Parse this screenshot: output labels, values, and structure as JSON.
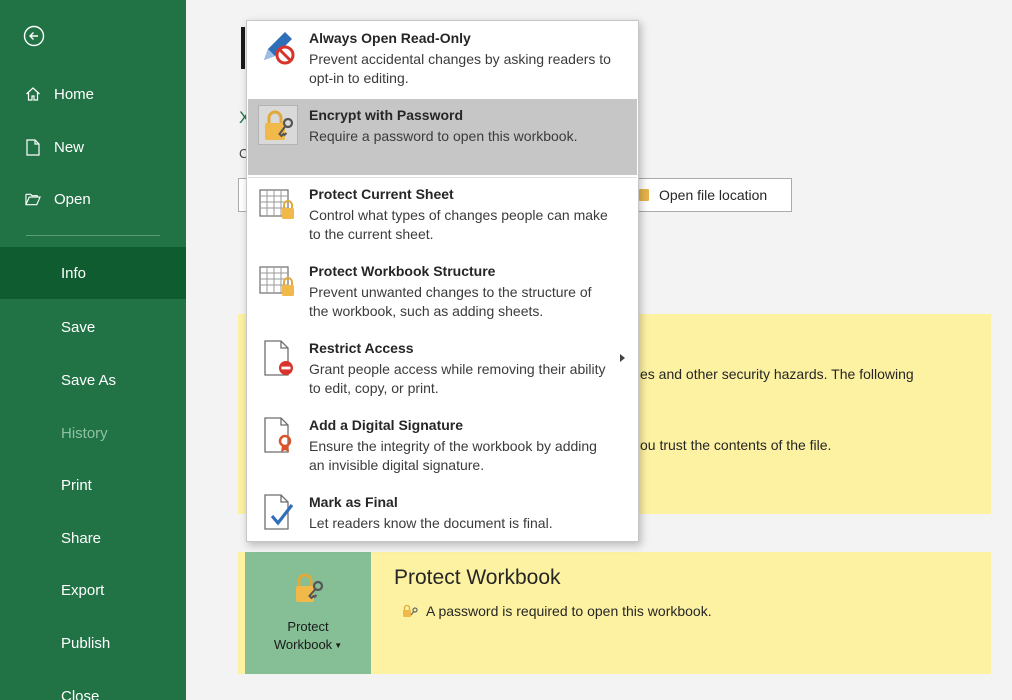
{
  "sidebar": {
    "back_icon": "back-arrow-circle-icon",
    "items": [
      {
        "label": "Home",
        "icon": "home-icon"
      },
      {
        "label": "New",
        "icon": "new-document-icon"
      },
      {
        "label": "Open",
        "icon": "open-folder-icon"
      },
      {
        "label": "Info"
      },
      {
        "label": "Save"
      },
      {
        "label": "Save As"
      },
      {
        "label": "History"
      },
      {
        "label": "Print"
      },
      {
        "label": "Share"
      },
      {
        "label": "Export"
      },
      {
        "label": "Publish"
      },
      {
        "label": "Close"
      }
    ],
    "active": "Info",
    "disabled": "History",
    "colors": {
      "background": "#217346",
      "active": "#0e5c2f"
    }
  },
  "info": {
    "workbook_icon_letter": "X",
    "path_letter": "C",
    "open_file_location": "Open file location",
    "security_warning_line1": "es and other security hazards. The following",
    "security_warning_line2": "ou trust the contents of the file.",
    "protect_workbook": {
      "button_label_line1": "Protect",
      "button_label_line2": "Workbook",
      "title": "Protect Workbook",
      "description": "A password is required to open this workbook."
    }
  },
  "protect_menu": {
    "items": [
      {
        "title": "Always Open Read-Only",
        "description": "Prevent accidental changes by asking readers to opt-in to editing.",
        "icon": "pencil-prohibited-icon"
      },
      {
        "title": "Encrypt with Password",
        "description": "Require a password to open this workbook.",
        "icon": "lock-key-icon",
        "highlighted": true
      },
      {
        "title": "Protect Current Sheet",
        "description": "Control what types of changes people can make to the current sheet.",
        "icon": "sheet-lock-icon"
      },
      {
        "title": "Protect Workbook Structure",
        "description": "Prevent unwanted changes to the structure of the workbook, such as adding sheets.",
        "icon": "workbook-structure-lock-icon"
      },
      {
        "title": "Restrict Access",
        "description": "Grant people access while removing their ability to edit, copy, or print.",
        "icon": "document-restricted-icon",
        "submenu": true
      },
      {
        "title": "Add a Digital Signature",
        "description": "Ensure the integrity of the workbook by adding an invisible digital signature.",
        "icon": "document-ribbon-icon"
      },
      {
        "title": "Mark as Final",
        "description": "Let readers know the document is final.",
        "icon": "document-checkmark-icon"
      }
    ]
  }
}
